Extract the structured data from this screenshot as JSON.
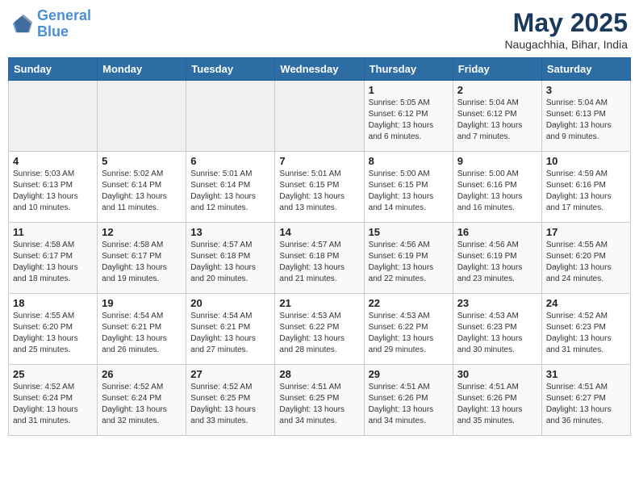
{
  "logo": {
    "line1": "General",
    "line2": "Blue"
  },
  "title": {
    "month_year": "May 2025",
    "location": "Naugachhia, Bihar, India"
  },
  "weekdays": [
    "Sunday",
    "Monday",
    "Tuesday",
    "Wednesday",
    "Thursday",
    "Friday",
    "Saturday"
  ],
  "weeks": [
    [
      {
        "day": "",
        "info": ""
      },
      {
        "day": "",
        "info": ""
      },
      {
        "day": "",
        "info": ""
      },
      {
        "day": "",
        "info": ""
      },
      {
        "day": "1",
        "info": "Sunrise: 5:05 AM\nSunset: 6:12 PM\nDaylight: 13 hours\nand 6 minutes."
      },
      {
        "day": "2",
        "info": "Sunrise: 5:04 AM\nSunset: 6:12 PM\nDaylight: 13 hours\nand 7 minutes."
      },
      {
        "day": "3",
        "info": "Sunrise: 5:04 AM\nSunset: 6:13 PM\nDaylight: 13 hours\nand 9 minutes."
      }
    ],
    [
      {
        "day": "4",
        "info": "Sunrise: 5:03 AM\nSunset: 6:13 PM\nDaylight: 13 hours\nand 10 minutes."
      },
      {
        "day": "5",
        "info": "Sunrise: 5:02 AM\nSunset: 6:14 PM\nDaylight: 13 hours\nand 11 minutes."
      },
      {
        "day": "6",
        "info": "Sunrise: 5:01 AM\nSunset: 6:14 PM\nDaylight: 13 hours\nand 12 minutes."
      },
      {
        "day": "7",
        "info": "Sunrise: 5:01 AM\nSunset: 6:15 PM\nDaylight: 13 hours\nand 13 minutes."
      },
      {
        "day": "8",
        "info": "Sunrise: 5:00 AM\nSunset: 6:15 PM\nDaylight: 13 hours\nand 14 minutes."
      },
      {
        "day": "9",
        "info": "Sunrise: 5:00 AM\nSunset: 6:16 PM\nDaylight: 13 hours\nand 16 minutes."
      },
      {
        "day": "10",
        "info": "Sunrise: 4:59 AM\nSunset: 6:16 PM\nDaylight: 13 hours\nand 17 minutes."
      }
    ],
    [
      {
        "day": "11",
        "info": "Sunrise: 4:58 AM\nSunset: 6:17 PM\nDaylight: 13 hours\nand 18 minutes."
      },
      {
        "day": "12",
        "info": "Sunrise: 4:58 AM\nSunset: 6:17 PM\nDaylight: 13 hours\nand 19 minutes."
      },
      {
        "day": "13",
        "info": "Sunrise: 4:57 AM\nSunset: 6:18 PM\nDaylight: 13 hours\nand 20 minutes."
      },
      {
        "day": "14",
        "info": "Sunrise: 4:57 AM\nSunset: 6:18 PM\nDaylight: 13 hours\nand 21 minutes."
      },
      {
        "day": "15",
        "info": "Sunrise: 4:56 AM\nSunset: 6:19 PM\nDaylight: 13 hours\nand 22 minutes."
      },
      {
        "day": "16",
        "info": "Sunrise: 4:56 AM\nSunset: 6:19 PM\nDaylight: 13 hours\nand 23 minutes."
      },
      {
        "day": "17",
        "info": "Sunrise: 4:55 AM\nSunset: 6:20 PM\nDaylight: 13 hours\nand 24 minutes."
      }
    ],
    [
      {
        "day": "18",
        "info": "Sunrise: 4:55 AM\nSunset: 6:20 PM\nDaylight: 13 hours\nand 25 minutes."
      },
      {
        "day": "19",
        "info": "Sunrise: 4:54 AM\nSunset: 6:21 PM\nDaylight: 13 hours\nand 26 minutes."
      },
      {
        "day": "20",
        "info": "Sunrise: 4:54 AM\nSunset: 6:21 PM\nDaylight: 13 hours\nand 27 minutes."
      },
      {
        "day": "21",
        "info": "Sunrise: 4:53 AM\nSunset: 6:22 PM\nDaylight: 13 hours\nand 28 minutes."
      },
      {
        "day": "22",
        "info": "Sunrise: 4:53 AM\nSunset: 6:22 PM\nDaylight: 13 hours\nand 29 minutes."
      },
      {
        "day": "23",
        "info": "Sunrise: 4:53 AM\nSunset: 6:23 PM\nDaylight: 13 hours\nand 30 minutes."
      },
      {
        "day": "24",
        "info": "Sunrise: 4:52 AM\nSunset: 6:23 PM\nDaylight: 13 hours\nand 31 minutes."
      }
    ],
    [
      {
        "day": "25",
        "info": "Sunrise: 4:52 AM\nSunset: 6:24 PM\nDaylight: 13 hours\nand 31 minutes."
      },
      {
        "day": "26",
        "info": "Sunrise: 4:52 AM\nSunset: 6:24 PM\nDaylight: 13 hours\nand 32 minutes."
      },
      {
        "day": "27",
        "info": "Sunrise: 4:52 AM\nSunset: 6:25 PM\nDaylight: 13 hours\nand 33 minutes."
      },
      {
        "day": "28",
        "info": "Sunrise: 4:51 AM\nSunset: 6:25 PM\nDaylight: 13 hours\nand 34 minutes."
      },
      {
        "day": "29",
        "info": "Sunrise: 4:51 AM\nSunset: 6:26 PM\nDaylight: 13 hours\nand 34 minutes."
      },
      {
        "day": "30",
        "info": "Sunrise: 4:51 AM\nSunset: 6:26 PM\nDaylight: 13 hours\nand 35 minutes."
      },
      {
        "day": "31",
        "info": "Sunrise: 4:51 AM\nSunset: 6:27 PM\nDaylight: 13 hours\nand 36 minutes."
      }
    ]
  ]
}
